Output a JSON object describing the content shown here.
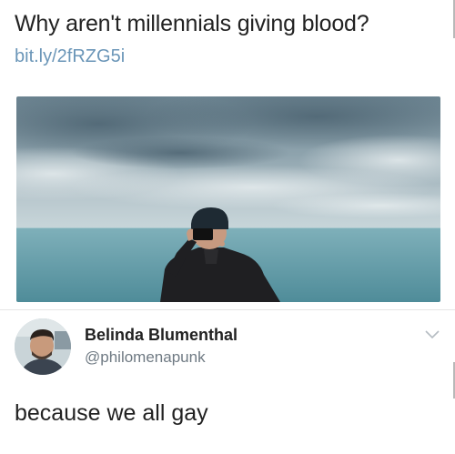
{
  "tweet": {
    "text": "Why aren't millennials giving blood?",
    "link": "bit.ly/2fRZG5i"
  },
  "media": {
    "icon": "photo-icon"
  },
  "reply": {
    "display_name": "Belinda Blumenthal",
    "handle": "@philomenapunk",
    "text": "because we all gay",
    "menu_icon": "chevron-down-icon"
  },
  "colors": {
    "link": "#6b96b8",
    "handle": "#6f7a83",
    "sea": "#5f97a3"
  }
}
